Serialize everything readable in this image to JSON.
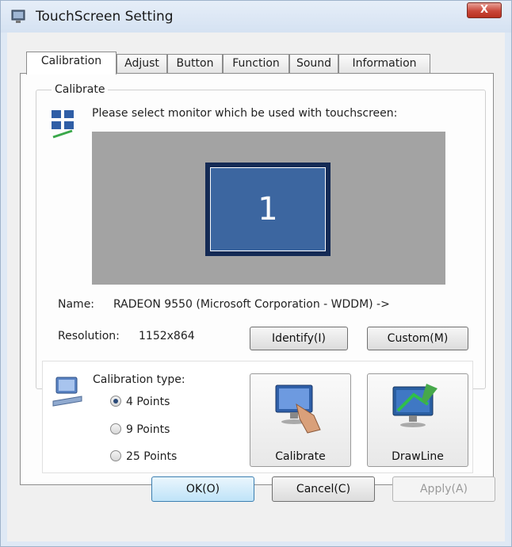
{
  "window": {
    "title": "TouchScreen Setting",
    "close_label": "X"
  },
  "tabs": [
    {
      "label": "Calibration",
      "active": true
    },
    {
      "label": "Adjust"
    },
    {
      "label": "Button"
    },
    {
      "label": "Function"
    },
    {
      "label": "Sound"
    },
    {
      "label": "Information"
    }
  ],
  "calibrate": {
    "group_title": "Calibrate",
    "instruction": "Please select monitor which be used with touchscreen:",
    "monitor_number": "1",
    "name_label": "Name:",
    "name_value": "RADEON 9550 (Microsoft Corporation - WDDM) ->",
    "resolution_label": "Resolution:",
    "resolution_value": "1152x864",
    "identify_label": "Identify(I)",
    "custom_label": "Custom(M)"
  },
  "calibration_type": {
    "label": "Calibration type:",
    "options": [
      "4 Points",
      "9 Points",
      "25 Points"
    ],
    "selected": "4 Points",
    "calibrate_button": "Calibrate",
    "drawline_button": "DrawLine"
  },
  "footer": {
    "ok": "OK(O)",
    "cancel": "Cancel(C)",
    "apply": "Apply(A)"
  },
  "colors": {
    "preview_bg": "#a3a3a3",
    "monitor_blue": "#3c66a0",
    "close_red": "#c9473a"
  }
}
